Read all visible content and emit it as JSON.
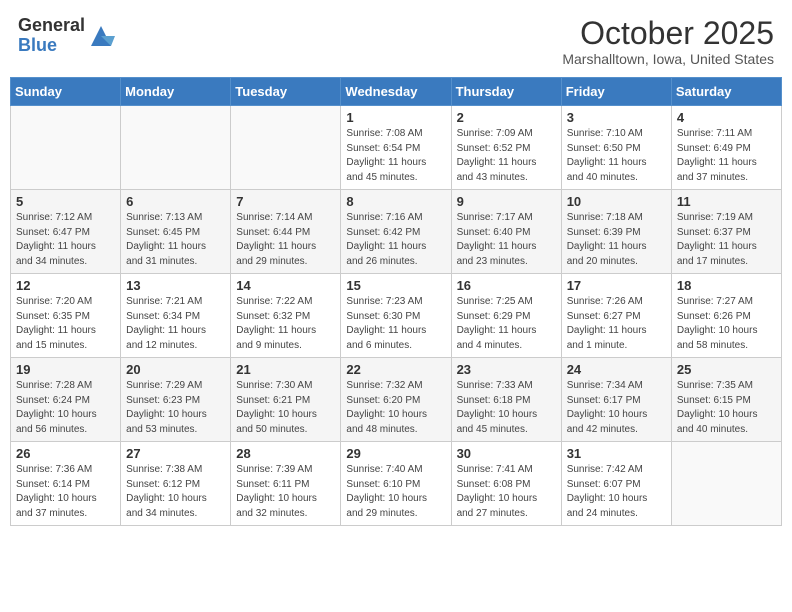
{
  "header": {
    "logo_general": "General",
    "logo_blue": "Blue",
    "month_title": "October 2025",
    "location": "Marshalltown, Iowa, United States"
  },
  "weekdays": [
    "Sunday",
    "Monday",
    "Tuesday",
    "Wednesday",
    "Thursday",
    "Friday",
    "Saturday"
  ],
  "weeks": [
    [
      {
        "day": "",
        "info": ""
      },
      {
        "day": "",
        "info": ""
      },
      {
        "day": "",
        "info": ""
      },
      {
        "day": "1",
        "info": "Sunrise: 7:08 AM\nSunset: 6:54 PM\nDaylight: 11 hours and 45 minutes."
      },
      {
        "day": "2",
        "info": "Sunrise: 7:09 AM\nSunset: 6:52 PM\nDaylight: 11 hours and 43 minutes."
      },
      {
        "day": "3",
        "info": "Sunrise: 7:10 AM\nSunset: 6:50 PM\nDaylight: 11 hours and 40 minutes."
      },
      {
        "day": "4",
        "info": "Sunrise: 7:11 AM\nSunset: 6:49 PM\nDaylight: 11 hours and 37 minutes."
      }
    ],
    [
      {
        "day": "5",
        "info": "Sunrise: 7:12 AM\nSunset: 6:47 PM\nDaylight: 11 hours and 34 minutes."
      },
      {
        "day": "6",
        "info": "Sunrise: 7:13 AM\nSunset: 6:45 PM\nDaylight: 11 hours and 31 minutes."
      },
      {
        "day": "7",
        "info": "Sunrise: 7:14 AM\nSunset: 6:44 PM\nDaylight: 11 hours and 29 minutes."
      },
      {
        "day": "8",
        "info": "Sunrise: 7:16 AM\nSunset: 6:42 PM\nDaylight: 11 hours and 26 minutes."
      },
      {
        "day": "9",
        "info": "Sunrise: 7:17 AM\nSunset: 6:40 PM\nDaylight: 11 hours and 23 minutes."
      },
      {
        "day": "10",
        "info": "Sunrise: 7:18 AM\nSunset: 6:39 PM\nDaylight: 11 hours and 20 minutes."
      },
      {
        "day": "11",
        "info": "Sunrise: 7:19 AM\nSunset: 6:37 PM\nDaylight: 11 hours and 17 minutes."
      }
    ],
    [
      {
        "day": "12",
        "info": "Sunrise: 7:20 AM\nSunset: 6:35 PM\nDaylight: 11 hours and 15 minutes."
      },
      {
        "day": "13",
        "info": "Sunrise: 7:21 AM\nSunset: 6:34 PM\nDaylight: 11 hours and 12 minutes."
      },
      {
        "day": "14",
        "info": "Sunrise: 7:22 AM\nSunset: 6:32 PM\nDaylight: 11 hours and 9 minutes."
      },
      {
        "day": "15",
        "info": "Sunrise: 7:23 AM\nSunset: 6:30 PM\nDaylight: 11 hours and 6 minutes."
      },
      {
        "day": "16",
        "info": "Sunrise: 7:25 AM\nSunset: 6:29 PM\nDaylight: 11 hours and 4 minutes."
      },
      {
        "day": "17",
        "info": "Sunrise: 7:26 AM\nSunset: 6:27 PM\nDaylight: 11 hours and 1 minute."
      },
      {
        "day": "18",
        "info": "Sunrise: 7:27 AM\nSunset: 6:26 PM\nDaylight: 10 hours and 58 minutes."
      }
    ],
    [
      {
        "day": "19",
        "info": "Sunrise: 7:28 AM\nSunset: 6:24 PM\nDaylight: 10 hours and 56 minutes."
      },
      {
        "day": "20",
        "info": "Sunrise: 7:29 AM\nSunset: 6:23 PM\nDaylight: 10 hours and 53 minutes."
      },
      {
        "day": "21",
        "info": "Sunrise: 7:30 AM\nSunset: 6:21 PM\nDaylight: 10 hours and 50 minutes."
      },
      {
        "day": "22",
        "info": "Sunrise: 7:32 AM\nSunset: 6:20 PM\nDaylight: 10 hours and 48 minutes."
      },
      {
        "day": "23",
        "info": "Sunrise: 7:33 AM\nSunset: 6:18 PM\nDaylight: 10 hours and 45 minutes."
      },
      {
        "day": "24",
        "info": "Sunrise: 7:34 AM\nSunset: 6:17 PM\nDaylight: 10 hours and 42 minutes."
      },
      {
        "day": "25",
        "info": "Sunrise: 7:35 AM\nSunset: 6:15 PM\nDaylight: 10 hours and 40 minutes."
      }
    ],
    [
      {
        "day": "26",
        "info": "Sunrise: 7:36 AM\nSunset: 6:14 PM\nDaylight: 10 hours and 37 minutes."
      },
      {
        "day": "27",
        "info": "Sunrise: 7:38 AM\nSunset: 6:12 PM\nDaylight: 10 hours and 34 minutes."
      },
      {
        "day": "28",
        "info": "Sunrise: 7:39 AM\nSunset: 6:11 PM\nDaylight: 10 hours and 32 minutes."
      },
      {
        "day": "29",
        "info": "Sunrise: 7:40 AM\nSunset: 6:10 PM\nDaylight: 10 hours and 29 minutes."
      },
      {
        "day": "30",
        "info": "Sunrise: 7:41 AM\nSunset: 6:08 PM\nDaylight: 10 hours and 27 minutes."
      },
      {
        "day": "31",
        "info": "Sunrise: 7:42 AM\nSunset: 6:07 PM\nDaylight: 10 hours and 24 minutes."
      },
      {
        "day": "",
        "info": ""
      }
    ]
  ]
}
